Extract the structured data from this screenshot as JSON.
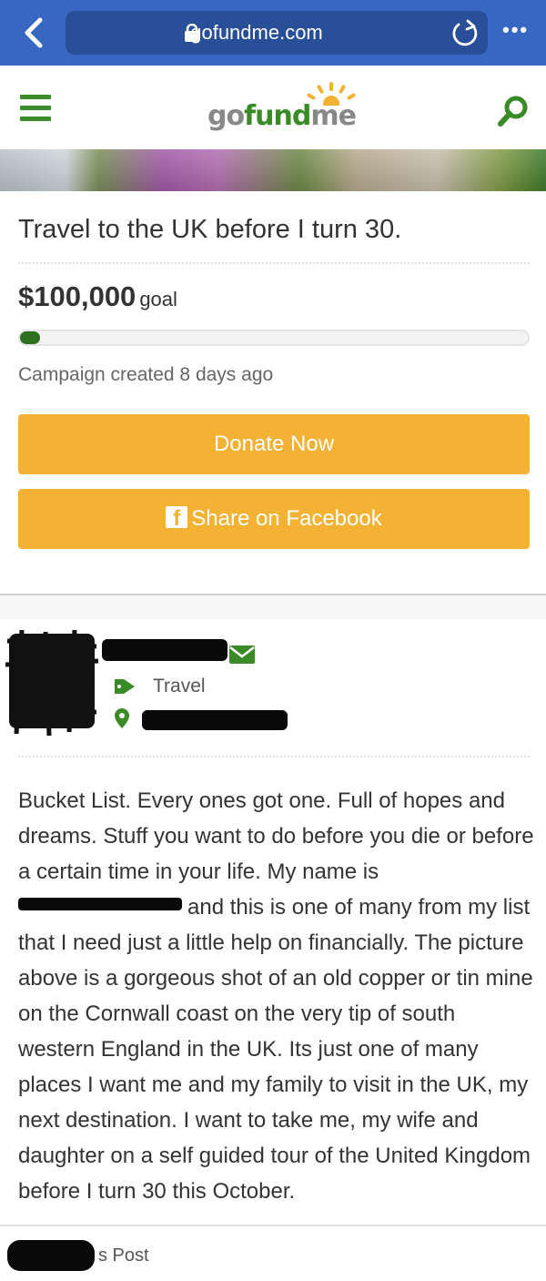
{
  "browser": {
    "url": "gofundme.com",
    "back_icon": "chevron-left-icon",
    "reload_icon": "reload-icon",
    "more_label": "•••"
  },
  "site": {
    "logo_go": "go",
    "logo_fund": "fund",
    "logo_me": "me",
    "brand_green": "#3a8a27",
    "accent_orange": "#f3b234"
  },
  "campaign": {
    "title": "Travel to the UK before I turn 30.",
    "goal_amount": "$100,000",
    "goal_word": "goal",
    "progress_fraction": 0.04,
    "created_text": "Campaign created 8 days ago",
    "donate_label": "Donate Now",
    "share_label": "Share on Facebook"
  },
  "organizer": {
    "category": "Travel"
  },
  "story": {
    "text_before_redaction": "Bucket List. Every ones got one. Full of hopes and dreams. Stuff you want to do before you die or before a certain time in your life. My name is",
    "text_after_redaction": "and this is one of many from my list that I need just a little help on financially. The picture above is a gorgeous shot of an old copper or tin mine on the Cornwall coast on the very tip of south western England in the UK. Its just one of many places I want me and my family to visit in the UK, my next destination. I want to take me, my wife and daughter on a self guided tour of the United Kingdom before I turn 30 this October."
  },
  "footer": {
    "post_label": "s Post"
  }
}
